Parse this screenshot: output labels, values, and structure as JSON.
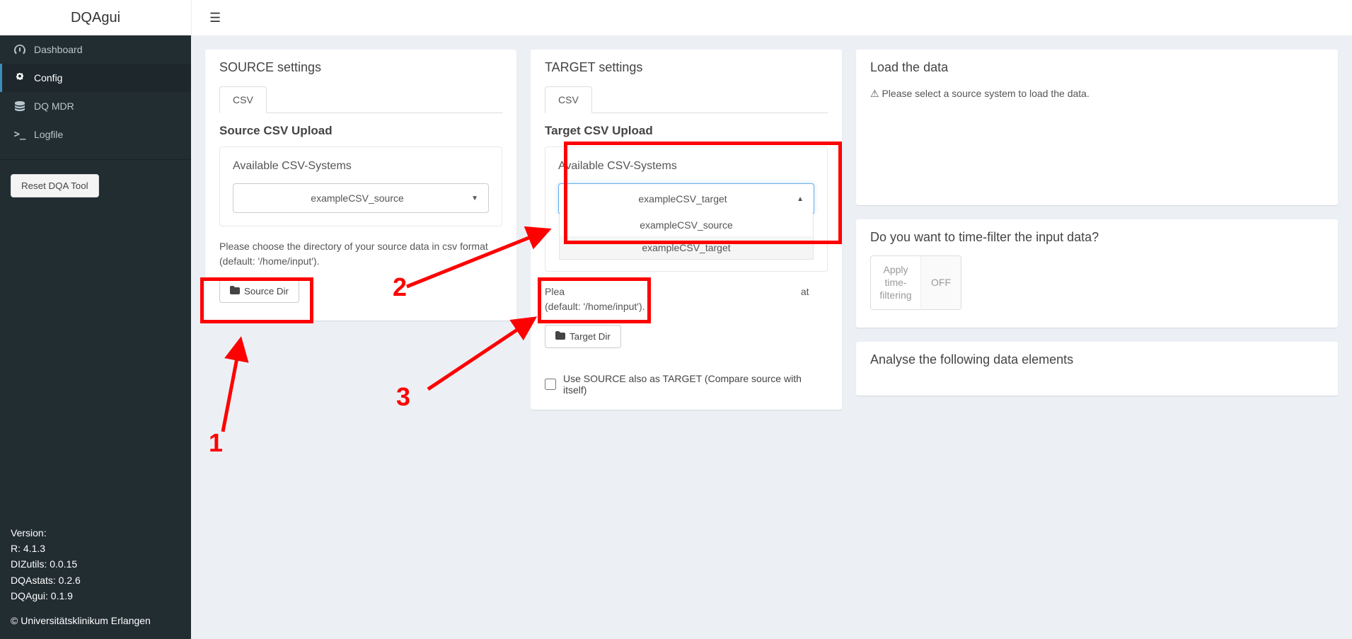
{
  "app_title": "DQAgui",
  "sidebar": {
    "items": [
      {
        "label": "Dashboard",
        "icon": "dashboard"
      },
      {
        "label": "Config",
        "icon": "gears"
      },
      {
        "label": "DQ MDR",
        "icon": "database"
      },
      {
        "label": "Logfile",
        "icon": "terminal"
      }
    ],
    "reset_btn": "Reset DQA Tool"
  },
  "versions": {
    "heading": "Version:",
    "r": "R: 4.1.3",
    "dizutils": "DIZutils: 0.0.15",
    "dqastats": "DQAstats: 0.2.6",
    "dqagui": "DQAgui: 0.1.9",
    "copyright": "© Universitätsklinikum Erlangen"
  },
  "source": {
    "title": "SOURCE settings",
    "tab": "CSV",
    "upload_title": "Source CSV Upload",
    "avail_title": "Available CSV-Systems",
    "selected": "exampleCSV_source",
    "helptext": "Please choose the directory of your source data in csv format (default: '/home/input').",
    "dir_btn": "Source Dir"
  },
  "target": {
    "title": "TARGET settings",
    "tab": "CSV",
    "upload_title": "Target CSV Upload",
    "avail_title": "Available CSV-Systems",
    "selected": "exampleCSV_target",
    "options": [
      "exampleCSV_source",
      "exampleCSV_target"
    ],
    "helptext_pre": "Plea",
    "helptext_post": "at (default: '/home/input').",
    "dir_btn": "Target Dir",
    "checkbox_label": "Use SOURCE also as TARGET (Compare source with itself)"
  },
  "right": {
    "load_title": "Load the data",
    "load_msg": "Please select a source system to load the data.",
    "filter_title": "Do you want to time-filter the input data?",
    "filter_label": "Apply time-filtering",
    "filter_state": "OFF",
    "analyse_title": "Analyse the following data elements"
  },
  "annotations": {
    "n1": "1",
    "n2": "2",
    "n3": "3"
  }
}
